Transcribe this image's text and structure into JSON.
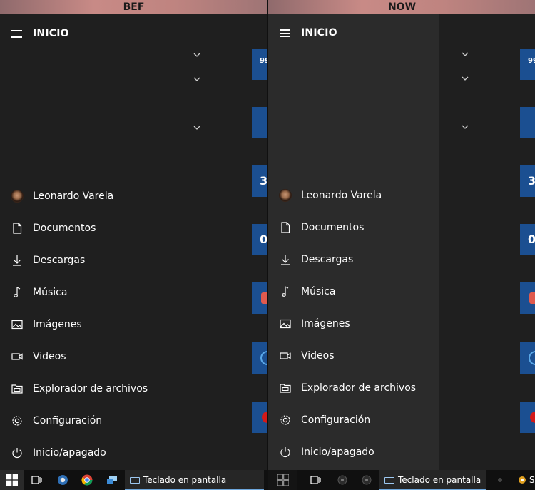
{
  "panels": {
    "bef": {
      "label": "BEF"
    },
    "now": {
      "label": "NOW"
    }
  },
  "start_menu": {
    "title": "INICIO",
    "items": [
      {
        "label": "Leonardo Varela",
        "icon": "user-avatar"
      },
      {
        "label": "Documentos",
        "icon": "document-icon"
      },
      {
        "label": "Descargas",
        "icon": "download-icon"
      },
      {
        "label": "Música",
        "icon": "music-icon"
      },
      {
        "label": "Imágenes",
        "icon": "image-icon"
      },
      {
        "label": "Videos",
        "icon": "video-icon"
      },
      {
        "label": "Explorador de archivos",
        "icon": "file-explorer-icon"
      },
      {
        "label": "Configuración",
        "icon": "gear-icon"
      },
      {
        "label": "Inicio/apagado",
        "icon": "power-icon"
      }
    ]
  },
  "tiles": [
    "99",
    "",
    "3",
    "0",
    "",
    "",
    ""
  ],
  "taskbar": {
    "active_app": "Teclado en pantalla",
    "extra_label": "S"
  },
  "colors": {
    "menu_bg": "#1f1f1f",
    "menu_bg_now": "#2b2b2b",
    "tile_blue": "#1b4f91",
    "taskbar": "#101010",
    "accent": "#6ea8de"
  }
}
